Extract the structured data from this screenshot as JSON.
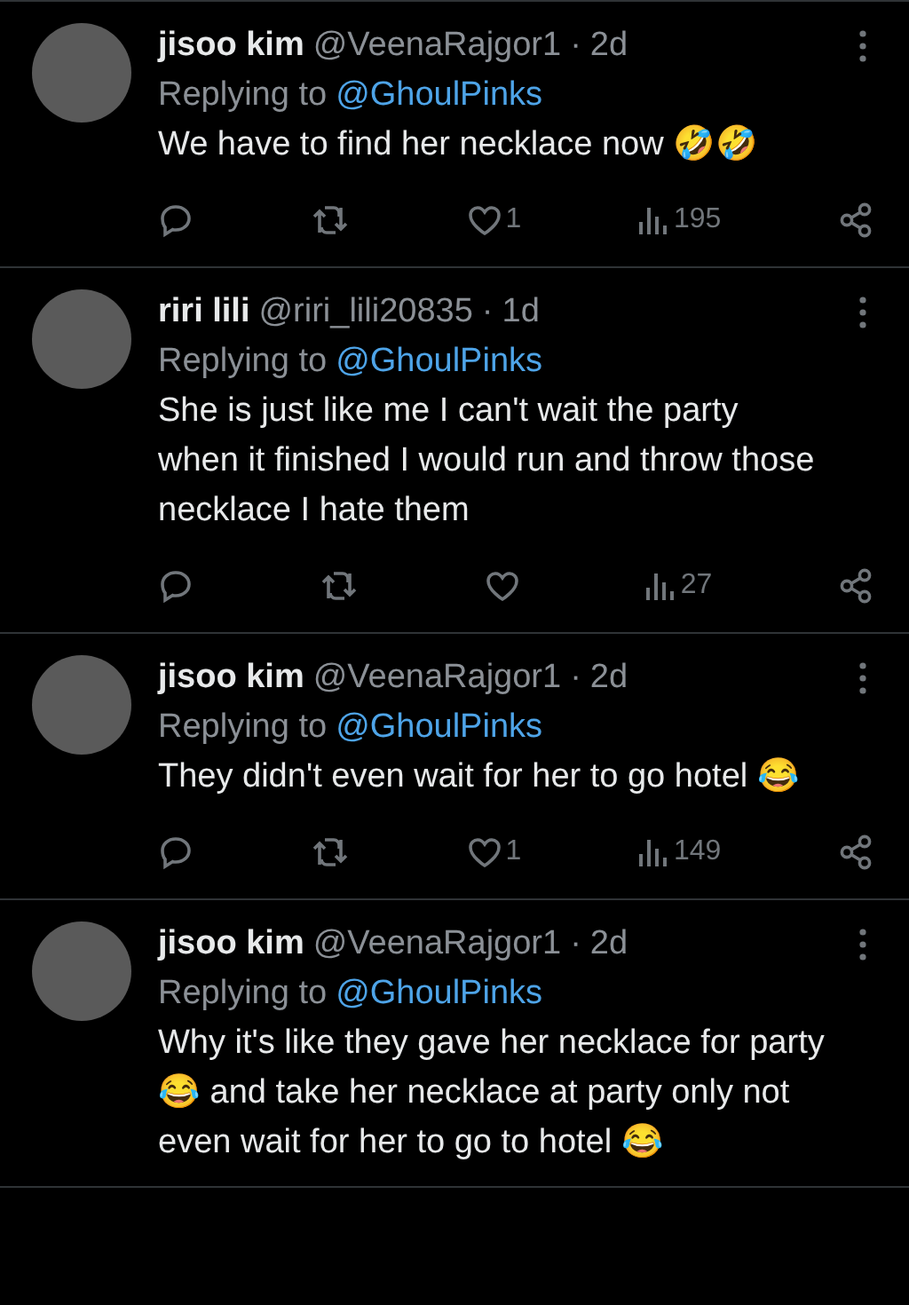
{
  "tweets": [
    {
      "name": "jisoo kim",
      "handle": "@VeenaRajgor1",
      "separator": "·",
      "time": "2d",
      "replying_label": "Replying to",
      "replying_to": "@GhoulPinks",
      "text": "We have to find her necklace now 🤣🤣",
      "likes": "1",
      "views": "195"
    },
    {
      "name": "riri lili",
      "handle": "@riri_lili20835",
      "separator": "·",
      "time": "1d",
      "replying_label": "Replying to",
      "replying_to": "@GhoulPinks",
      "text": "She is just like me I can't wait the party when it finished I would run and throw those necklace I hate them",
      "views": "27"
    },
    {
      "name": "jisoo kim",
      "handle": "@VeenaRajgor1",
      "separator": "·",
      "time": "2d",
      "replying_label": "Replying to",
      "replying_to": "@GhoulPinks",
      "text": "They didn't even wait for her to go hotel 😂",
      "likes": "1",
      "views": "149"
    },
    {
      "name": "jisoo kim",
      "handle": "@VeenaRajgor1",
      "separator": "·",
      "time": "2d",
      "replying_label": "Replying to",
      "replying_to": "@GhoulPinks",
      "text": "Why it's like they gave her necklace for party 😂 and take her necklace at party only not even wait for her to go to hotel 😂"
    }
  ]
}
